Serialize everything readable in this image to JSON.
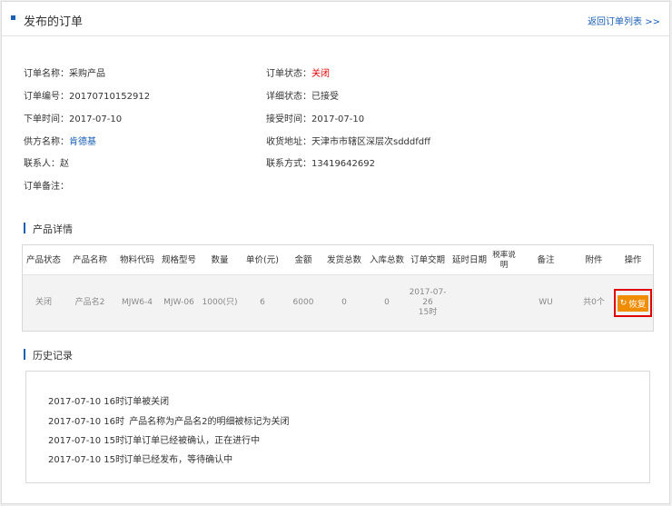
{
  "header": {
    "title": "发布的订单",
    "back_link": "返回订单列表 >>"
  },
  "info": {
    "left": [
      {
        "label": "订单名称：",
        "value": "采购产品"
      },
      {
        "label": "订单编号：",
        "value": "20170710152912"
      },
      {
        "label": "下单时间：",
        "value": "2017-07-10"
      },
      {
        "label": "供方名称：",
        "value": "肯德基"
      },
      {
        "label": "联系人：",
        "value": "赵"
      },
      {
        "label": "订单备注：",
        "value": ""
      }
    ],
    "right": [
      {
        "label": "订单状态：",
        "value": "关闭"
      },
      {
        "label": "详细状态：",
        "value": "已接受"
      },
      {
        "label": "接受时间：",
        "value": "2017-07-10"
      },
      {
        "label": "收货地址：",
        "value": "天津市市辖区深层次sdddfdff"
      },
      {
        "label": "联系方式：",
        "value": "13419642692"
      }
    ]
  },
  "products": {
    "title": "产品详情",
    "columns": [
      "产品状态",
      "产品名称",
      "物料代码",
      "规格型号",
      "数量",
      "单价(元)",
      "金额",
      "发货总数",
      "入库总数",
      "订单交期",
      "延时日期",
      "税率说明",
      "备注",
      "附件",
      "操作"
    ],
    "rows": [
      {
        "status": "关闭",
        "name": "产品名2",
        "code": "MJW6-4",
        "spec": "MJW-06",
        "qty": "1000(只)",
        "price": "6",
        "amount": "6000",
        "shipped": "0",
        "stocked": "0",
        "due_date": "2017-07-26",
        "due_time": "15时",
        "delay": "",
        "tax": "",
        "remark": "WU",
        "attach": "共0个",
        "action": "恢复"
      }
    ]
  },
  "history": {
    "title": "历史记录",
    "items": [
      {
        "time": "2017-07-10 16时",
        "text": "订单被关闭",
        "highlight": true
      },
      {
        "time": "2017-07-10 16时",
        "text": "产品名称为产品名2的明细被标记为关闭",
        "highlight": false
      },
      {
        "time": "2017-07-10 15时",
        "text": "订单订单已经被确认，正在进行中",
        "highlight": false
      },
      {
        "time": "2017-07-10 15时",
        "text": "订单已经发布，等待确认中",
        "highlight": false
      }
    ]
  },
  "colors": {
    "accent": "#1a5fb4",
    "danger": "#e60000",
    "button": "#f08c00"
  }
}
